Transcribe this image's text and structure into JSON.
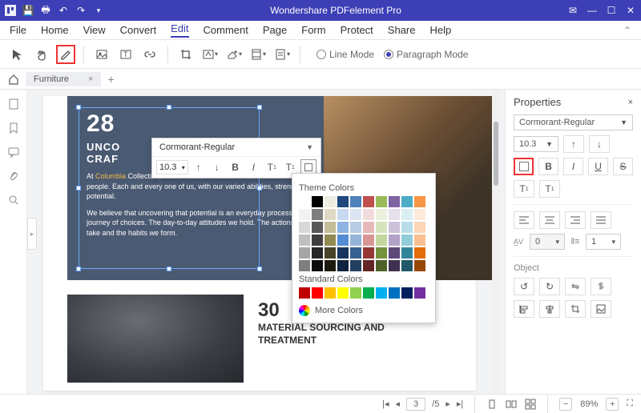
{
  "titlebar": {
    "title": "Wondershare PDFelement Pro"
  },
  "menu": {
    "items": [
      "File",
      "Home",
      "View",
      "Convert",
      "Edit",
      "Comment",
      "Page",
      "Form",
      "Protect",
      "Share",
      "Help"
    ],
    "active": 4
  },
  "toolbar": {
    "mode": {
      "line": "Line Mode",
      "paragraph": "Paragraph Mode",
      "selected": "paragraph"
    }
  },
  "tabs": {
    "items": [
      {
        "label": "Furniture"
      }
    ]
  },
  "document": {
    "block1": {
      "number": "28",
      "heading_l1": "UNCO",
      "heading_l2": "CRAF",
      "para1_pre": "At ",
      "para1_link": "Columbia",
      "para1_post": " Collective, we believe that our success starts from our people. Each and every one of us, with our varied abilities, strengths and potential.",
      "para2": "We believe that uncovering that potential is an everyday process. A journey of choices. The day-to-day attitudes we hold. The actions we take and the habits we form."
    },
    "block2": {
      "number": "30",
      "heading": "MATERIAL SOURCING AND TREATMENT"
    }
  },
  "font_popup": {
    "font": "Cormorant-Regular",
    "size": "10.3"
  },
  "color_popup": {
    "theme_label": "Theme Colors",
    "standard_label": "Standard Colors",
    "more_label": "More Colors",
    "theme_colors": [
      [
        "#ffffff",
        "#000000",
        "#eeece1",
        "#1f497d",
        "#4f81bd",
        "#c0504d",
        "#9bbb59",
        "#8064a2",
        "#4bacc6",
        "#f79646"
      ],
      [
        "#f2f2f2",
        "#7f7f7f",
        "#ddd9c3",
        "#c6d9f0",
        "#dbe5f1",
        "#f2dcdb",
        "#ebf1dd",
        "#e5e0ec",
        "#dbeef3",
        "#fdeada"
      ],
      [
        "#d8d8d8",
        "#595959",
        "#c4bd97",
        "#8db3e2",
        "#b8cce4",
        "#e5b9b7",
        "#d7e3bc",
        "#ccc1d9",
        "#b7dde8",
        "#fbd5b5"
      ],
      [
        "#bfbfbf",
        "#3f3f3f",
        "#938953",
        "#548dd4",
        "#95b3d7",
        "#d99694",
        "#c3d69b",
        "#b2a2c7",
        "#92cddc",
        "#fac08f"
      ],
      [
        "#a5a5a5",
        "#262626",
        "#494429",
        "#17365d",
        "#366092",
        "#953734",
        "#76923c",
        "#5f497a",
        "#31859b",
        "#e36c09"
      ],
      [
        "#7f7f7f",
        "#0c0c0c",
        "#1d1b10",
        "#0f243e",
        "#244061",
        "#632423",
        "#4f6128",
        "#3f3151",
        "#205867",
        "#974806"
      ]
    ],
    "standard_colors": [
      "#c00000",
      "#ff0000",
      "#ffc000",
      "#ffff00",
      "#92d050",
      "#00b050",
      "#00b0f0",
      "#0070c0",
      "#002060",
      "#7030a0"
    ]
  },
  "properties": {
    "title": "Properties",
    "font": "Cormorant-Regular",
    "size": "10.3",
    "av": "0",
    "line": "1",
    "object_label": "Object"
  },
  "status": {
    "page_current": "3",
    "page_total": "/5",
    "zoom": "89%"
  }
}
